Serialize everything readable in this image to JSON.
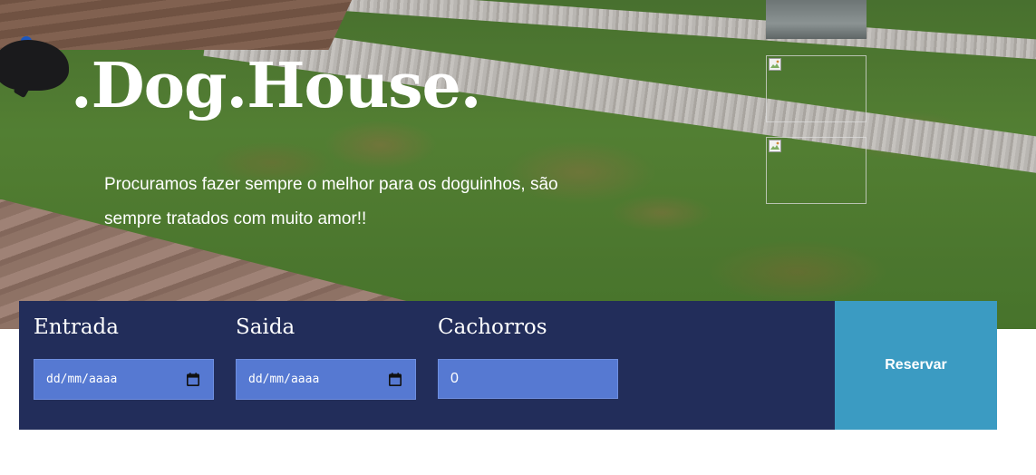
{
  "brand": {
    "logo_text": ".Dog.House."
  },
  "hero": {
    "tagline": "Procuramos fazer sempre o melhor para os doguinhos, são sempre tratados com muito amor!!"
  },
  "booking": {
    "entrada": {
      "label": "Entrada",
      "value": "dd/mm/aaaa"
    },
    "saida": {
      "label": "Saida",
      "value": "dd/mm/aaaa"
    },
    "cachorros": {
      "label": "Cachorros",
      "value": "0"
    },
    "reserve_label": "Reservar"
  },
  "colors": {
    "booking_bg": "#222d5a",
    "input_bg": "#5679d2",
    "button_bg": "#3b9bc2"
  },
  "icons": [
    "calendar-icon",
    "broken-image-icon"
  ]
}
